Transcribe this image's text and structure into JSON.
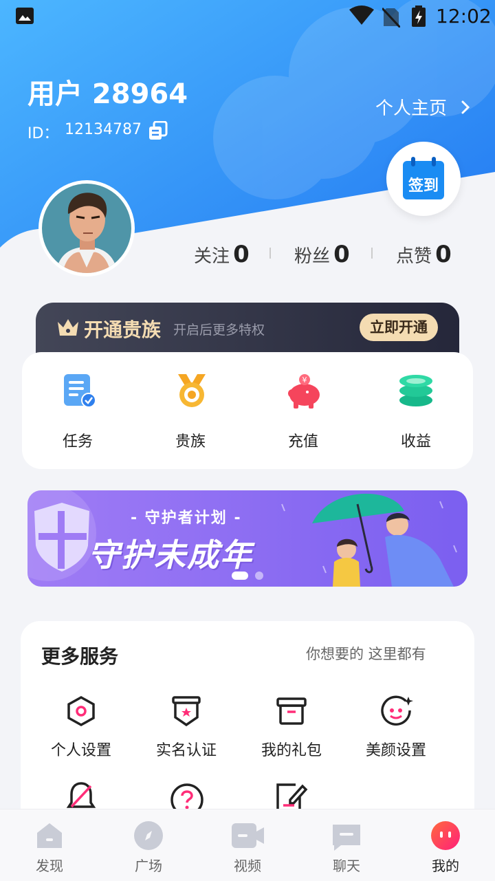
{
  "status_bar": {
    "time": "12:02"
  },
  "profile": {
    "username": "用户 28964",
    "id_label": "ID：",
    "id_value": "12134787",
    "homepage_label": "个人主页",
    "checkin_label": "签到"
  },
  "stats": [
    {
      "label": "关注",
      "value": "0"
    },
    {
      "label": "粉丝",
      "value": "0"
    },
    {
      "label": "点赞",
      "value": "0"
    }
  ],
  "vip": {
    "title": "开通贵族",
    "subtitle": "开启后更多特权",
    "button": "立即开通"
  },
  "quick": [
    {
      "label": "任务",
      "icon": "task-icon"
    },
    {
      "label": "贵族",
      "icon": "medal-icon"
    },
    {
      "label": "充值",
      "icon": "piggy-bank-icon"
    },
    {
      "label": "收益",
      "icon": "coins-icon"
    }
  ],
  "banner": {
    "subtitle": "- 守护者计划 -",
    "title": "守护未成年"
  },
  "services": {
    "title": "更多服务",
    "subtitle": "你想要的 这里都有",
    "items": [
      {
        "label": "个人设置",
        "icon": "hexagon-settings-icon"
      },
      {
        "label": "实名认证",
        "icon": "id-verify-icon"
      },
      {
        "label": "我的礼包",
        "icon": "gift-box-icon"
      },
      {
        "label": "美颜设置",
        "icon": "beauty-face-icon"
      }
    ],
    "row2_icons": [
      "bell-off-icon",
      "help-icon",
      "edit-note-icon"
    ]
  },
  "tabs": [
    {
      "label": "发现",
      "icon": "home-icon"
    },
    {
      "label": "广场",
      "icon": "compass-icon"
    },
    {
      "label": "视频",
      "icon": "video-icon"
    },
    {
      "label": "聊天",
      "icon": "chat-icon"
    },
    {
      "label": "我的",
      "icon": "me-icon"
    }
  ],
  "colors": {
    "accent": "#ff2d78",
    "header_blue": "#2f86f6",
    "vip_gold": "#f4dcb2"
  }
}
